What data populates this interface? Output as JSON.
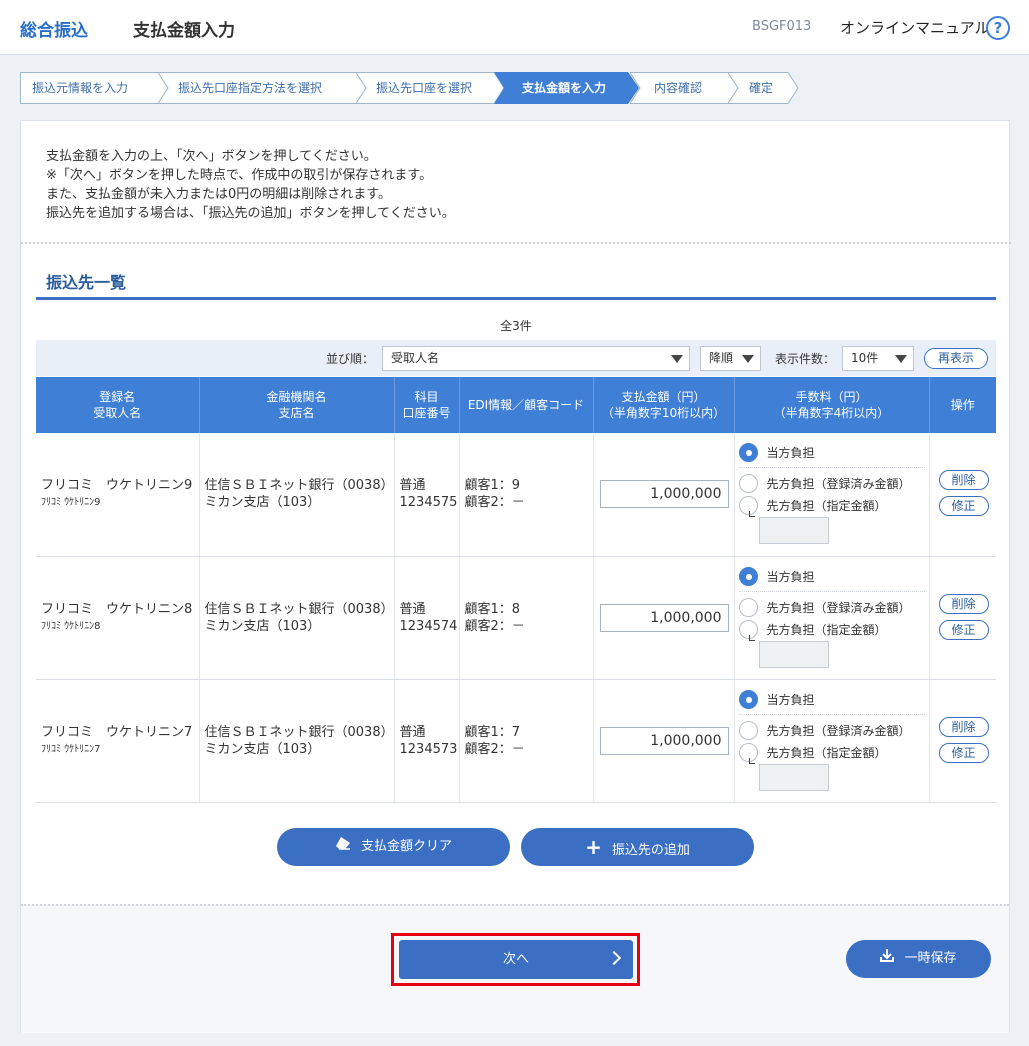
{
  "header": {
    "app_title": "総合振込",
    "screen_title": "支払金額入力",
    "screen_code": "BSGF013",
    "manual_link": "オンラインマニュアル",
    "help_glyph": "?"
  },
  "steps": [
    {
      "label": "振込元情報を入力",
      "active": false
    },
    {
      "label": "振込先口座指定方法を選択",
      "active": false
    },
    {
      "label": "振込先口座を選択",
      "active": false
    },
    {
      "label": "支払金額を入力",
      "active": true
    },
    {
      "label": "内容確認",
      "active": false
    },
    {
      "label": "確定",
      "active": false
    }
  ],
  "intro": {
    "line1": "支払金額を入力の上、「次へ」ボタンを押してください。",
    "line2": "※「次へ」ボタンを押した時点で、作成中の取引が保存されます。",
    "line3": "また、支払金額が未入力または0円の明細は削除されます。",
    "line4": "振込先を追加する場合は、「振込先の追加」ボタンを押してください。"
  },
  "list": {
    "title": "振込先一覧",
    "total_count": "全3件",
    "sort_label": "並び順：",
    "sort_value": "受取人名",
    "order_value": "降順",
    "display_count_label": "表示件数：",
    "display_count_value": "10件",
    "redisplay_button": "再表示",
    "columns": {
      "name_1": "登録名",
      "name_2": "受取人名",
      "bank_1": "金融機関名",
      "bank_2": "支店名",
      "account_1": "科目",
      "account_2": "口座番号",
      "edi": "EDI情報／顧客コード",
      "amount_1": "支払金額（円）",
      "amount_2": "（半角数字10桁以内）",
      "fee_1": "手数料（円）",
      "fee_2": "（半角数字4桁以内）",
      "ops": "操作"
    },
    "fee_options": {
      "ours": "当方負担",
      "theirs_registered": "先方負担（登録済み金額）",
      "theirs_specified": "先方負担（指定金額）"
    },
    "rows": [
      {
        "registered_name": "フリコミ　ウケトリニン9",
        "payee_kana": "ﾌﾘｺﾐ ｳｹﾄﾘﾆﾝ9",
        "bank": "住信ＳＢＩネット銀行（0038）",
        "branch": "ミカン支店（103）",
        "account_type": "普通",
        "account_no": "1234575",
        "edi_1": "顧客1：9",
        "edi_2": "顧客2：－",
        "amount": "1,000,000",
        "delete": "削除",
        "edit": "修正"
      },
      {
        "registered_name": "フリコミ　ウケトリニン8",
        "payee_kana": "ﾌﾘｺﾐ ｳｹﾄﾘﾆﾝ8",
        "bank": "住信ＳＢＩネット銀行（0038）",
        "branch": "ミカン支店（103）",
        "account_type": "普通",
        "account_no": "1234574",
        "edi_1": "顧客1：8",
        "edi_2": "顧客2：－",
        "amount": "1,000,000",
        "delete": "削除",
        "edit": "修正"
      },
      {
        "registered_name": "フリコミ　ウケトリニン7",
        "payee_kana": "ﾌﾘｺﾐ ｳｹﾄﾘﾆﾝ7",
        "bank": "住信ＳＢＩネット銀行（0038）",
        "branch": "ミカン支店（103）",
        "account_type": "普通",
        "account_no": "1234573",
        "edi_1": "顧客1：7",
        "edi_2": "顧客2：－",
        "amount": "1,000,000",
        "delete": "削除",
        "edit": "修正"
      }
    ]
  },
  "actions": {
    "clear_amount": "支払金額クリア",
    "add_payee": "振込先の追加",
    "next": "次へ",
    "temp_save": "一時保存"
  },
  "colors": {
    "accent": "#3a6fc4",
    "header_blue": "#3f7fd6",
    "highlight_border": "#e60012"
  }
}
